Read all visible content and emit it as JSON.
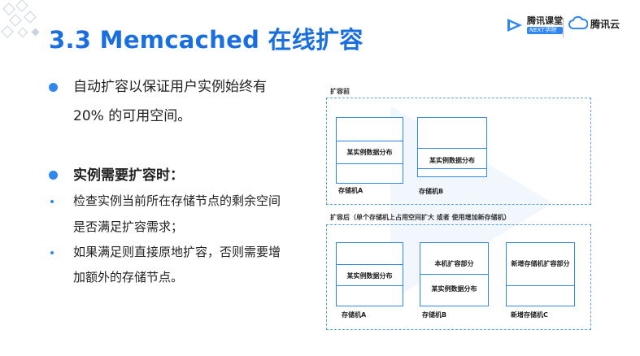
{
  "header": {
    "title": "3.3 Memcached 在线扩容",
    "brand_ketang_name": "腾讯课堂",
    "brand_ketang_tag": "NEXT学院",
    "brand_cloud_name": "腾讯云"
  },
  "left": {
    "bullet1_line1": "自动扩容以保证用户实例始终有",
    "bullet1_line2": "20% 的可用空间。",
    "bullet2_heading": "实例需要扩容时：",
    "sub1_line1": "检查实例当前所在存储节点的剩余空间",
    "sub1_line2": "是否满足扩容需求；",
    "sub2_line1": "如果满足则直接原地扩容，否则需要增",
    "sub2_line2": "加额外的存储节点。"
  },
  "diagram": {
    "before_label": "扩容前",
    "after_label": "扩容后（单个存储机上占用空间扩大 或者 使用增加新存储机）",
    "before": {
      "a_data": "某实例数据分布",
      "a_caption": "存储机A",
      "b_data": "某实例数据分布",
      "b_caption": "存储机B"
    },
    "after": {
      "a_data": "某实例数据分布",
      "a_caption": "存储机A",
      "b_expand": "本机扩容部分",
      "b_data": "某实例数据分布",
      "b_caption": "存储机B",
      "c_expand": "新增存储机扩容部分",
      "c_caption": "新增存储机C"
    }
  },
  "colors": {
    "accent": "#1a6fe0",
    "bullet": "#2f87f2",
    "dash": "#5aa0e6"
  }
}
